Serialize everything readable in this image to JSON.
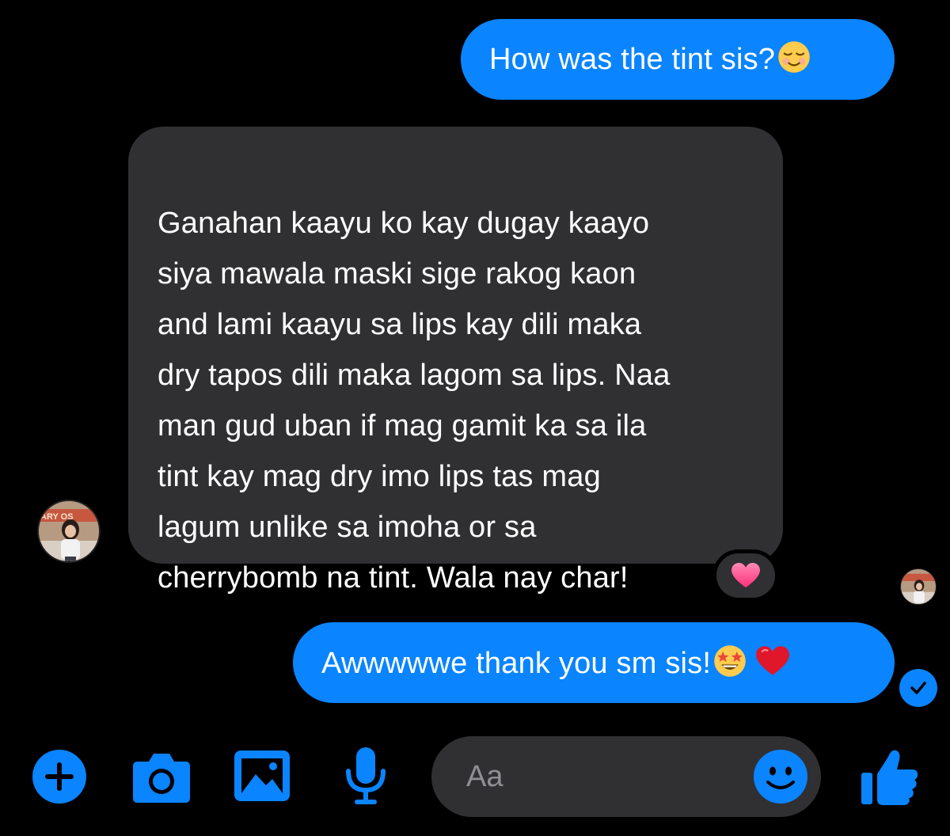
{
  "messages": [
    {
      "direction": "sent",
      "text": "How was the tint sis?",
      "emoji": "relieved-face-emoji"
    },
    {
      "direction": "received",
      "text": "Ganahan kaayu ko kay dugay kaayo\nsiya mawala maski sige rakog kaon\nand lami kaayu sa lips kay dili maka\ndry tapos dili maka lagom sa lips. Naa\nman gud uban if mag gamit ka sa ila\ntint kay mag dry imo lips tas mag\nlagum unlike sa imoha or sa\ncherrybomb na tint. Wala nay char!",
      "reaction": "pink-heart-icon"
    },
    {
      "direction": "sent",
      "text": "Awwwwwe thank you sm sis!",
      "emoji": [
        "star-struck-emoji",
        "red-heart-emoji"
      ],
      "status": "delivered"
    }
  ],
  "avatar_banner_text": "ARY OS",
  "composer": {
    "placeholder": "Aa"
  },
  "toolbar": {
    "icons": [
      "plus-icon",
      "camera-icon",
      "gallery-icon",
      "microphone-icon",
      "emoji-icon",
      "thumbs-up-icon"
    ]
  },
  "colors": {
    "background": "#000000",
    "sent_bubble": "#0a84ff",
    "received_bubble": "#303032",
    "accent": "#0a84ff",
    "text": "#ffffff",
    "placeholder": "#8e8e93"
  }
}
